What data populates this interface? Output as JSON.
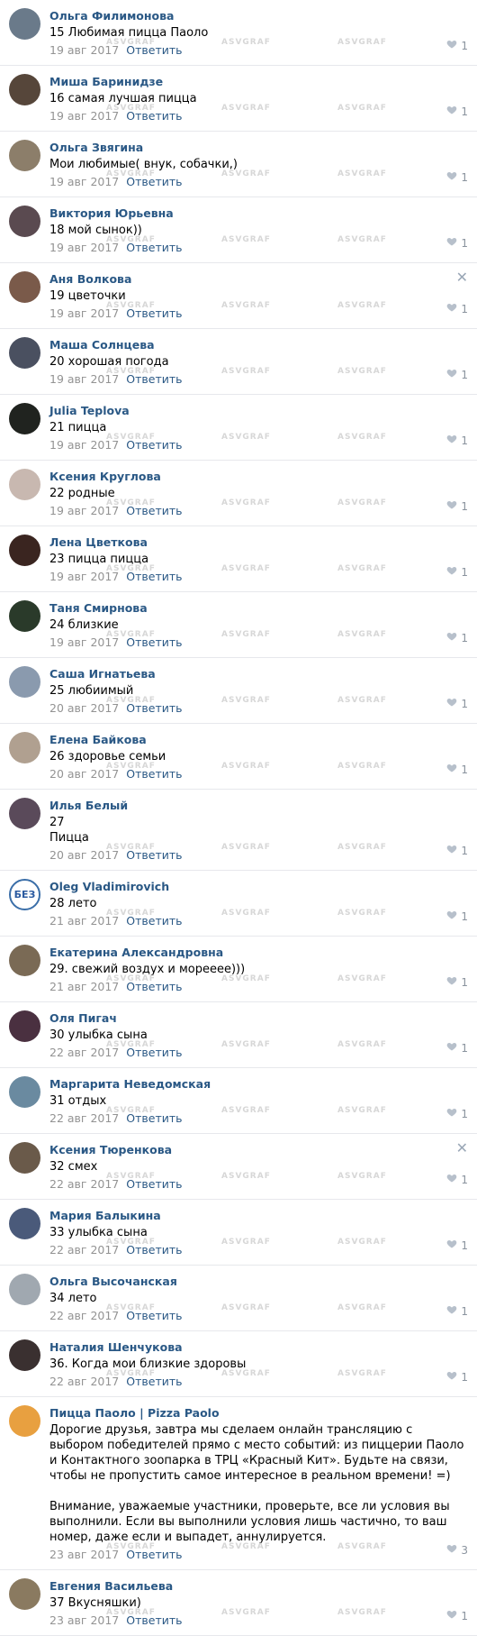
{
  "watermark": "ASVGRAF",
  "reply_label": "Ответить",
  "comments": [
    {
      "author": "Ольга Филимонова",
      "text": "15 Любимая пицца Паоло",
      "date": "19 авг 2017",
      "likes": "1",
      "color": "#6a7a8a"
    },
    {
      "author": "Миша Баринидзе",
      "text": "16 самая лучшая пицца",
      "date": "19 авг 2017",
      "likes": "1",
      "color": "#56463a"
    },
    {
      "author": "Ольга Звягина",
      "text": "Мои любимые( внук, собачки,)",
      "date": "19 авг 2017",
      "likes": "1",
      "color": "#8c7e6a"
    },
    {
      "author": "Виктория Юрьевна",
      "text": "18 мой сынок))",
      "date": "19 авг 2017",
      "likes": "1",
      "color": "#5a4a50"
    },
    {
      "author": "Аня Волкова",
      "text": "19 цветочки",
      "date": "19 авг 2017",
      "likes": "1",
      "color": "#7a5a4a",
      "close": true
    },
    {
      "author": "Маша Солнцева",
      "text": "20 хорошая погода",
      "date": "19 авг 2017",
      "likes": "1",
      "color": "#4a5060"
    },
    {
      "author": "Julia Teplova",
      "text": "21 пицца",
      "date": "19 авг 2017",
      "likes": "1",
      "color": "#20231f"
    },
    {
      "author": "Ксения Круглова",
      "text": "22 родные",
      "date": "19 авг 2017",
      "likes": "1",
      "color": "#c8b8b0"
    },
    {
      "author": "Лена Цветкова",
      "text": "23 пицца пицца",
      "date": "19 авг 2017",
      "likes": "1",
      "color": "#3a2520"
    },
    {
      "author": "Таня Смирнова",
      "text": "24 близкие",
      "date": "19 авг 2017",
      "likes": "1",
      "color": "#2a3a2a"
    },
    {
      "author": "Саша Игнатьева",
      "text": "25 любиимый",
      "date": "20 авг 2017",
      "likes": "1",
      "color": "#8a9aae"
    },
    {
      "author": "Елена Байкова",
      "text": "26 здоровье семьи",
      "date": "20 авг 2017",
      "likes": "1",
      "color": "#b0a090"
    },
    {
      "author": "Илья Белый",
      "text": "27\nПицца",
      "date": "20 авг 2017",
      "likes": "1",
      "color": "#5a4a5a"
    },
    {
      "author": "Oleg Vladimirovich",
      "text": "28 лето",
      "date": "21 авг 2017",
      "likes": "1",
      "color": "#ffffff",
      "initials": "БЕЗ"
    },
    {
      "author": "Екатерина Александровна",
      "text": "29. свежий воздух и мореееe)))",
      "date": "21 авг 2017",
      "likes": "1",
      "color": "#7a6a55"
    },
    {
      "author": "Оля Пигач",
      "text": "30 улыбка сына",
      "date": "22 авг 2017",
      "likes": "1",
      "color": "#4a3040"
    },
    {
      "author": "Маргарита Неведомская",
      "text": "31 отдых",
      "date": "22 авг 2017",
      "likes": "1",
      "color": "#6a8aa0"
    },
    {
      "author": "Ксения Тюренкова",
      "text": "32 смех",
      "date": "22 авг 2017",
      "likes": "1",
      "color": "#6a5a4a",
      "close": true
    },
    {
      "author": "Мария Балыкина",
      "text": "33 улыбка сына",
      "date": "22 авг 2017",
      "likes": "1",
      "color": "#4a5a7a"
    },
    {
      "author": "Ольга Высочанская",
      "text": "34 лето",
      "date": "22 авг 2017",
      "likes": "1",
      "color": "#a0a8b0"
    },
    {
      "author": "Наталия Шенчукова",
      "text": "36. Когда мои близкие здоровы",
      "date": "22 авг 2017",
      "likes": "1",
      "color": "#3a3030"
    },
    {
      "author": "Пицца Паоло | Pizza Paolo",
      "text": "Дорогие друзья, завтра мы сделаем онлайн трансляцию с выбором победителей прямо с место событий: из пиццерии Паоло и Контактного зоопарка в ТРЦ «Красный Кит». Будьте на связи, чтобы не пропустить самое интересное в реальном времени! =)\n\nВнимание, уважаемые участники, проверьте, все ли условия вы выполнили. Если вы выполнили условия лишь частично, то ваш номер, даже если и выпадет, аннулируется.",
      "date": "23 авг 2017",
      "likes": "3",
      "color": "#e8a040"
    },
    {
      "author": "Евгения Васильева",
      "text": "37 Вкусняшки)",
      "date": "23 авг 2017",
      "likes": "1",
      "color": "#8a7a60"
    }
  ]
}
